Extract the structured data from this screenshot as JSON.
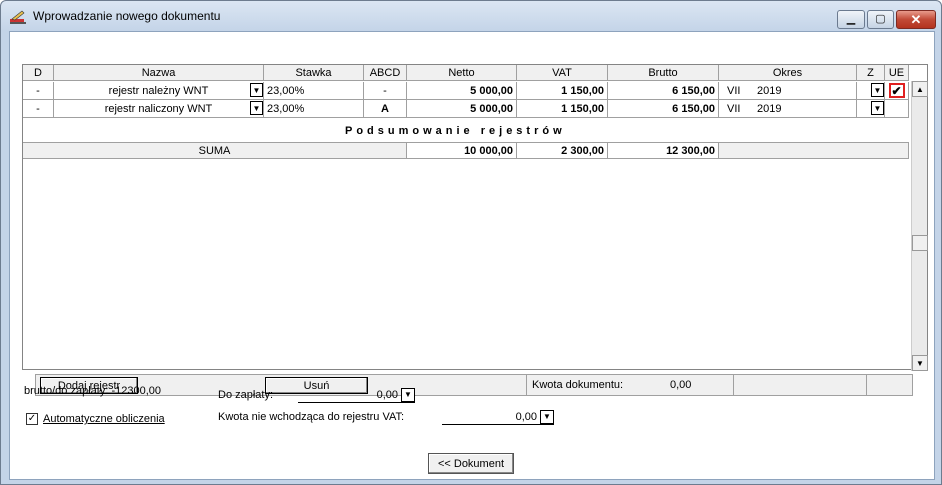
{
  "window": {
    "title": "Wprowadzanie nowego dokumentu"
  },
  "columns": [
    "D",
    "Nazwa",
    "Stawka",
    "ABCD",
    "Netto",
    "VAT",
    "Brutto",
    "Okres",
    "Z",
    "UE"
  ],
  "rows": [
    {
      "d": "-",
      "nazwa": "rejestr należny WNT",
      "stawka": "23,00%",
      "abcd": "-",
      "netto": "5 000,00",
      "vat": "1 150,00",
      "brutto": "6 150,00",
      "okres_m": "VII",
      "okres_y": "2019",
      "ue": "✔"
    },
    {
      "d": "-",
      "nazwa": "rejestr naliczony WNT",
      "stawka": "23,00%",
      "abcd": "A",
      "netto": "5 000,00",
      "vat": "1 150,00",
      "brutto": "6 150,00",
      "okres_m": "VII",
      "okres_y": "2019",
      "ue": ""
    }
  ],
  "summary": {
    "title": "Podsumowanie rejestrów",
    "label": "SUMA",
    "netto": "10 000,00",
    "vat": "2 300,00",
    "brutto": "12 300,00"
  },
  "buttons": {
    "add": "Dodaj rejestr",
    "remove": "Usuń",
    "back": "<< Dokument"
  },
  "kwota_dokumentu": {
    "label": "Kwota dokumentu:",
    "value": "0,00"
  },
  "footer": {
    "brutto_label": "brutto/do zapłaty: -12300,00",
    "auto_calc": "Automatyczne obliczenia",
    "do_zaplaty_label": "Do zapłaty:",
    "do_zaplaty_value": "0,00",
    "kwota_nie_label": "Kwota nie wchodząca do rejestru VAT:",
    "kwota_nie_value": "0,00"
  }
}
